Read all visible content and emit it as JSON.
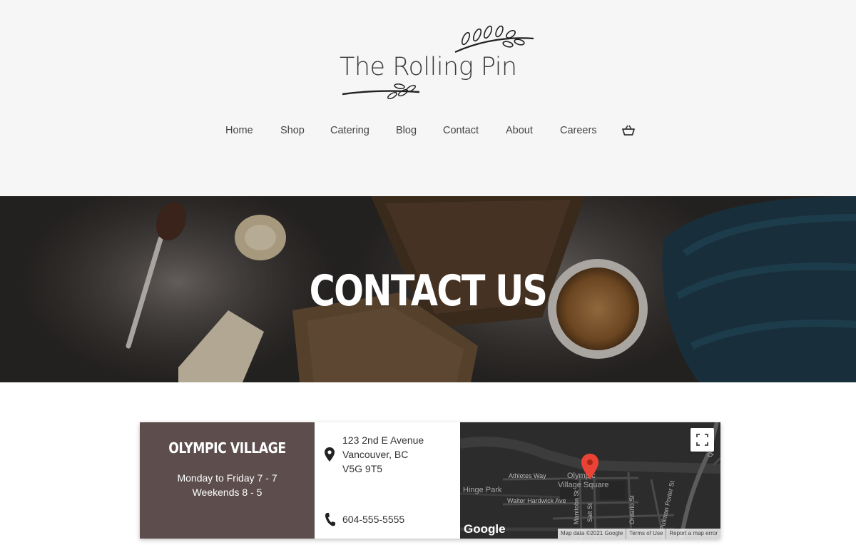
{
  "brand": {
    "name": "The Rolling Pin"
  },
  "nav": {
    "items": [
      {
        "label": "Home"
      },
      {
        "label": "Shop"
      },
      {
        "label": "Catering"
      },
      {
        "label": "Blog"
      },
      {
        "label": "Contact"
      },
      {
        "label": "About"
      },
      {
        "label": "Careers"
      }
    ],
    "cart_icon": "basket-icon"
  },
  "hero": {
    "title": "CONTACT US"
  },
  "location": {
    "name": "OLYMPIC VILLAGE",
    "hours_weekday": "Monday to Friday 7 - 7",
    "hours_weekend": "Weekends 8 - 5",
    "address_line1": "123 2nd E Avenue",
    "address_line2": "Vancouver, BC",
    "address_line3": "V5G 9T5",
    "phone": "604-555-5555",
    "address_icon": "map-pin-icon",
    "phone_icon": "phone-icon"
  },
  "map": {
    "labels": {
      "athletes_way": "Athletes Way",
      "olympic_village_1": "Olympic",
      "olympic_village_2": "Village Square",
      "hinge_park": "Hinge Park",
      "walter_hardwick": "Walter Hardwick Ave",
      "manitoba": "Manitoba St",
      "salt": "Salt St",
      "ontario": "Ontario St",
      "pullman": "Pullman Porter St",
      "quebec": "Qu"
    },
    "google": "Google",
    "footer": {
      "data": "Map data ©2021 Google",
      "terms": "Terms of Use",
      "report": "Report a map error"
    },
    "marker_color": "#ea4335"
  },
  "colors": {
    "header_bg": "#f7f6f6",
    "location_panel": "#5d4d4d",
    "map_bg": "#2b2b2b"
  }
}
